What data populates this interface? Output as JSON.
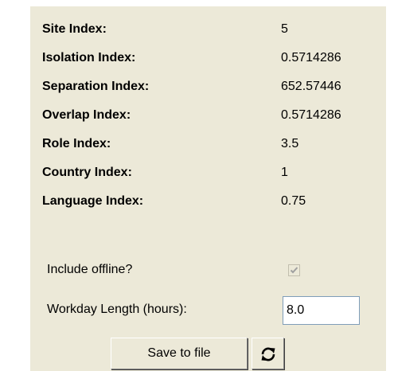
{
  "metrics": [
    {
      "label": "Site Index:",
      "value": "5"
    },
    {
      "label": "Isolation Index:",
      "value": "0.5714286"
    },
    {
      "label": "Separation Index:",
      "value": "652.57446"
    },
    {
      "label": "Overlap Index:",
      "value": "0.5714286"
    },
    {
      "label": "Role Index:",
      "value": "3.5"
    },
    {
      "label": "Country Index:",
      "value": "1"
    },
    {
      "label": "Language Index:",
      "value": "0.75"
    }
  ],
  "options": {
    "include_offline_label": "Include offline?",
    "include_offline_checked": true,
    "workday_label": "Workday Length (hours):",
    "workday_value": "8.0"
  },
  "buttons": {
    "save_label": "Save to file",
    "refresh_icon": "refresh-icon"
  },
  "colors": {
    "panel_background": "#ECE9D8",
    "page_background": "#FFFFFF",
    "checkbox_mark": "#A0A0A0"
  }
}
